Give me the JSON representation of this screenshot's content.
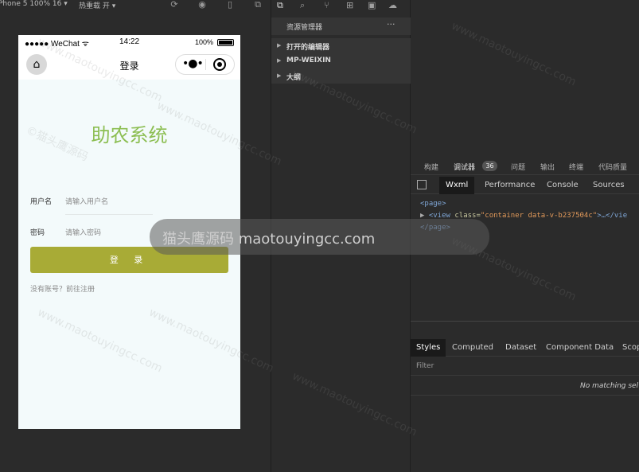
{
  "simulator": {
    "device_label": "Phone 5 100% 16 ▾",
    "hot_reload_label": "热重载 开 ▾",
    "phone": {
      "carrier": "●●●●● WeChat ᯤ",
      "time": "14:22",
      "battery": "100%",
      "nav_title": "登录",
      "app_title": "助农系统",
      "username_label": "用户名",
      "username_placeholder": "请输入用户名",
      "password_label": "密码",
      "password_placeholder": "请输入密码",
      "login_button": "登 录",
      "register_link": "没有账号？前往注册"
    }
  },
  "explorer": {
    "title": "资源管理器",
    "more": "···",
    "items": [
      {
        "label": "打开的编辑器"
      },
      {
        "label": "MP-WEIXIN"
      },
      {
        "label": "大纲"
      }
    ]
  },
  "devtools": {
    "top_tabs": [
      "构建",
      "调试器",
      "问题",
      "输出",
      "终端",
      "代码质量"
    ],
    "debugger_badge": "36",
    "panel_tabs": [
      "Wxml",
      "Performance",
      "Console",
      "Sources"
    ],
    "dom": {
      "line1": "<page>",
      "line2_tag": "<view",
      "line2_attr": " class=",
      "line2_val": "\"container data-v-b237504c\"",
      "line2_rest": ">…</vie",
      "line3": "</page>"
    },
    "style_tabs": [
      "Styles",
      "Computed",
      "Dataset",
      "Component Data",
      "Scop"
    ],
    "filter_placeholder": "Filter",
    "no_match": "No matching sel"
  },
  "watermark": {
    "banner": "猫头鹰源码 maotouyingcc.com",
    "text": "www.maotouyingcc.com",
    "text_cn": "©猫头鹰源码"
  }
}
